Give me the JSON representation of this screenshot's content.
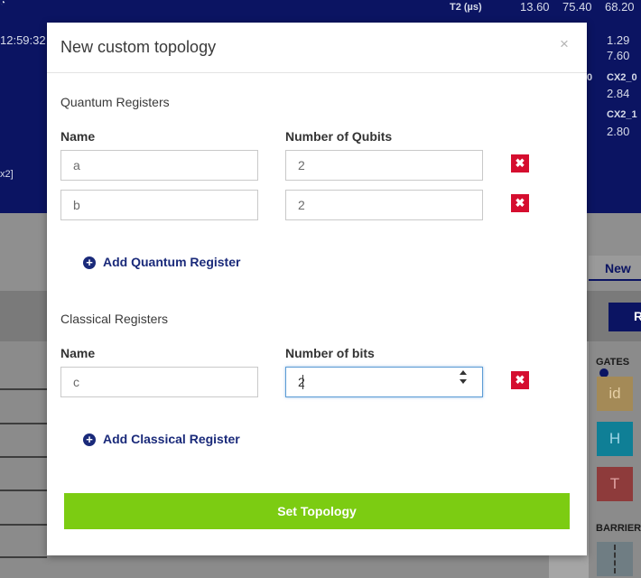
{
  "background": {
    "t2_label": "T2 (µs)",
    "t2_values": [
      "13.60",
      "75.40",
      "68.20"
    ],
    "time": "12:59:32",
    "values_right": [
      "1.29",
      "7.60",
      "2.84",
      "2.80"
    ],
    "cx_labels": [
      "CX2_0",
      "CX2_1"
    ],
    "partial_zero": "0",
    "partial_x2": "x2]",
    "new_tab": "New",
    "run_partial": "R",
    "gates_label": "GATES",
    "gate_id": "id",
    "gate_h": "H",
    "gate_t": "T",
    "barrier_label": "BARRIER"
  },
  "modal": {
    "title": "New custom topology",
    "close_glyph": "×",
    "quantum": {
      "section_title": "Quantum Registers",
      "name_header": "Name",
      "count_header": "Number of Qubits",
      "registers": [
        {
          "name": "a",
          "count": "2"
        },
        {
          "name": "b",
          "count": "2"
        }
      ],
      "add_label": "Add Quantum Register"
    },
    "classical": {
      "section_title": "Classical Registers",
      "name_header": "Name",
      "count_header": "Number of bits",
      "registers": [
        {
          "name": "c",
          "count": "2"
        }
      ],
      "add_label": "Add Classical Register"
    },
    "delete_glyph": "✖",
    "plus_glyph": "+",
    "submit_label": "Set Topology"
  },
  "colors": {
    "primary_blue": "#0b1462",
    "submit_green": "#7ccc12",
    "delete_red": "#d50e2f"
  }
}
